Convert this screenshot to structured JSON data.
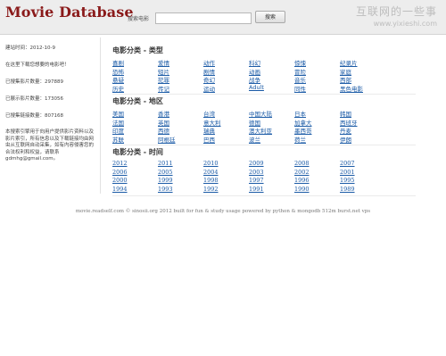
{
  "header": {
    "site_title": "Movie Database",
    "search_label": "搜索电影",
    "search_placeholder": "",
    "search_button": "搜索"
  },
  "watermark": {
    "text": "互联网的一些事",
    "url": "www.yixieshi.com"
  },
  "sidebar": {
    "build_time": "建站时间：2012-10-9",
    "welcome": "在这里下载您想要的电影吧！",
    "movies_count": "已搜集影片数量：297889",
    "movies_shown": "已展示影片数量：173056",
    "links_count": "已搜集链接数量：807168",
    "description": "本搜索引擎用于向用户提供影片资料以及影片索引，所有信息以及下载链接均由网虫从互联网自动采集，如有内容侵害您的合法权利和权益，请联系gdmhg@gmail.com。"
  },
  "sections": [
    {
      "title": "电影分类 - 类型",
      "rows": [
        [
          "喜剧",
          "爱情",
          "动作",
          "科幻",
          "惊悚",
          "纪录片"
        ],
        [
          "恐怖",
          "短片",
          "剧情",
          "动画",
          "冒险",
          "家庭"
        ],
        [
          "悬疑",
          "犯罪",
          "奇幻",
          "战争",
          "音乐",
          "西部"
        ],
        [
          "历史",
          "传记",
          "运动",
          "Adult",
          "同性",
          "黑色电影"
        ]
      ]
    },
    {
      "title": "电影分类 - 地区",
      "rows": [
        [
          "美国",
          "香港",
          "台湾",
          "中国大陆",
          "日本",
          "韩国"
        ],
        [
          "法国",
          "英国",
          "意大利",
          "德国",
          "加拿大",
          "西班牙"
        ],
        [
          "印度",
          "西德",
          "瑞典",
          "澳大利亚",
          "墨西哥",
          "丹麦"
        ],
        [
          "苏联",
          "阿根廷",
          "巴西",
          "波兰",
          "荷兰",
          "伊朗"
        ]
      ]
    },
    {
      "title": "电影分类 - 时间",
      "rows": [
        [
          "2012",
          "2011",
          "2010",
          "2009",
          "2008",
          "2007"
        ],
        [
          "2006",
          "2005",
          "2004",
          "2003",
          "2002",
          "2001"
        ],
        [
          "2000",
          "1999",
          "1998",
          "1997",
          "1996",
          "1995"
        ],
        [
          "1994",
          "1993",
          "1992",
          "1991",
          "1990",
          "1989"
        ]
      ]
    }
  ],
  "footer": {
    "text": "movie.readself.com © sinosii.org 2012 built for fun & study usage powered by python & mongodb 512m burst.net vps"
  }
}
